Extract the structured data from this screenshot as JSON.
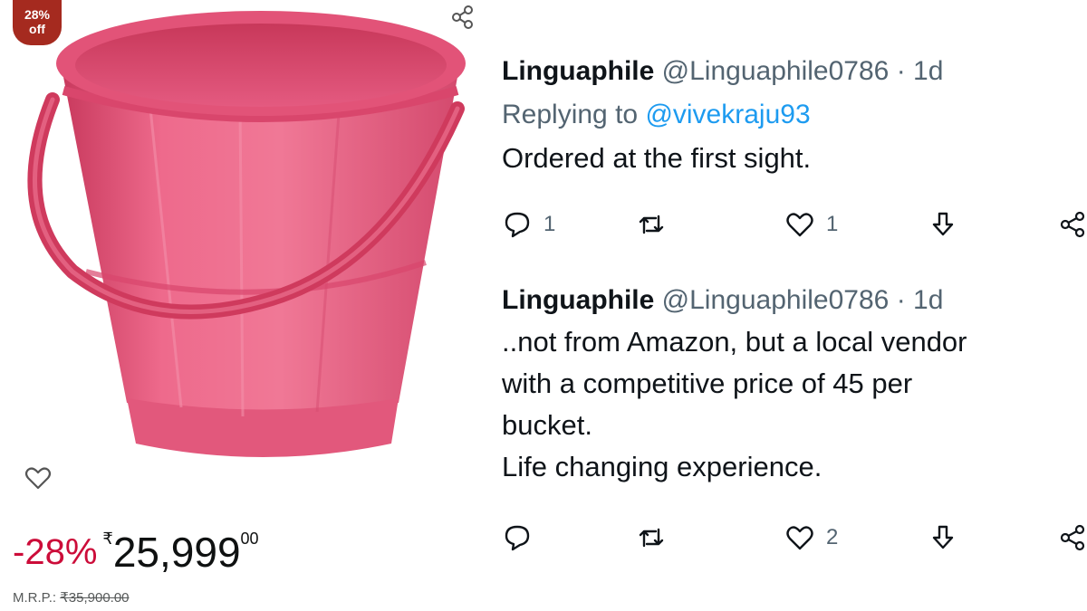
{
  "product": {
    "badge_pct": "28%",
    "badge_off": "off",
    "discount": "-28%",
    "currency_symbol": "₹",
    "price": "25,999",
    "price_decimal": "00",
    "mrp_label": "M.R.P.:",
    "mrp_value": "₹35,900.00",
    "icons": [
      "share-icon",
      "heart-outline-icon"
    ],
    "colors": {
      "badge": "#a52a1f",
      "discount": "#cc0c39",
      "bucket": "#e9557a"
    }
  },
  "tweets": [
    {
      "name": "Linguaphile",
      "handle": "@Linguaphile0786",
      "separator": "·",
      "time": "1d",
      "replying_prefix": "Replying to",
      "replying_to": "@vivekraju93",
      "lines": [
        "Ordered at the first sight."
      ],
      "replies": "1",
      "retweets": "",
      "likes": "1"
    },
    {
      "name": "Linguaphile",
      "handle": "@Linguaphile0786",
      "separator": "·",
      "time": "1d",
      "lines": [
        "..not from Amazon, but a local vendor",
        "with a competitive price of 45 per",
        "bucket.",
        "Life changing experience."
      ],
      "replies": "",
      "retweets": "",
      "likes": "2"
    }
  ],
  "tweet_icons": [
    "reply-icon",
    "retweet-icon",
    "like-icon",
    "download-icon",
    "share-icon"
  ],
  "accent_color": "#1d9bf0"
}
